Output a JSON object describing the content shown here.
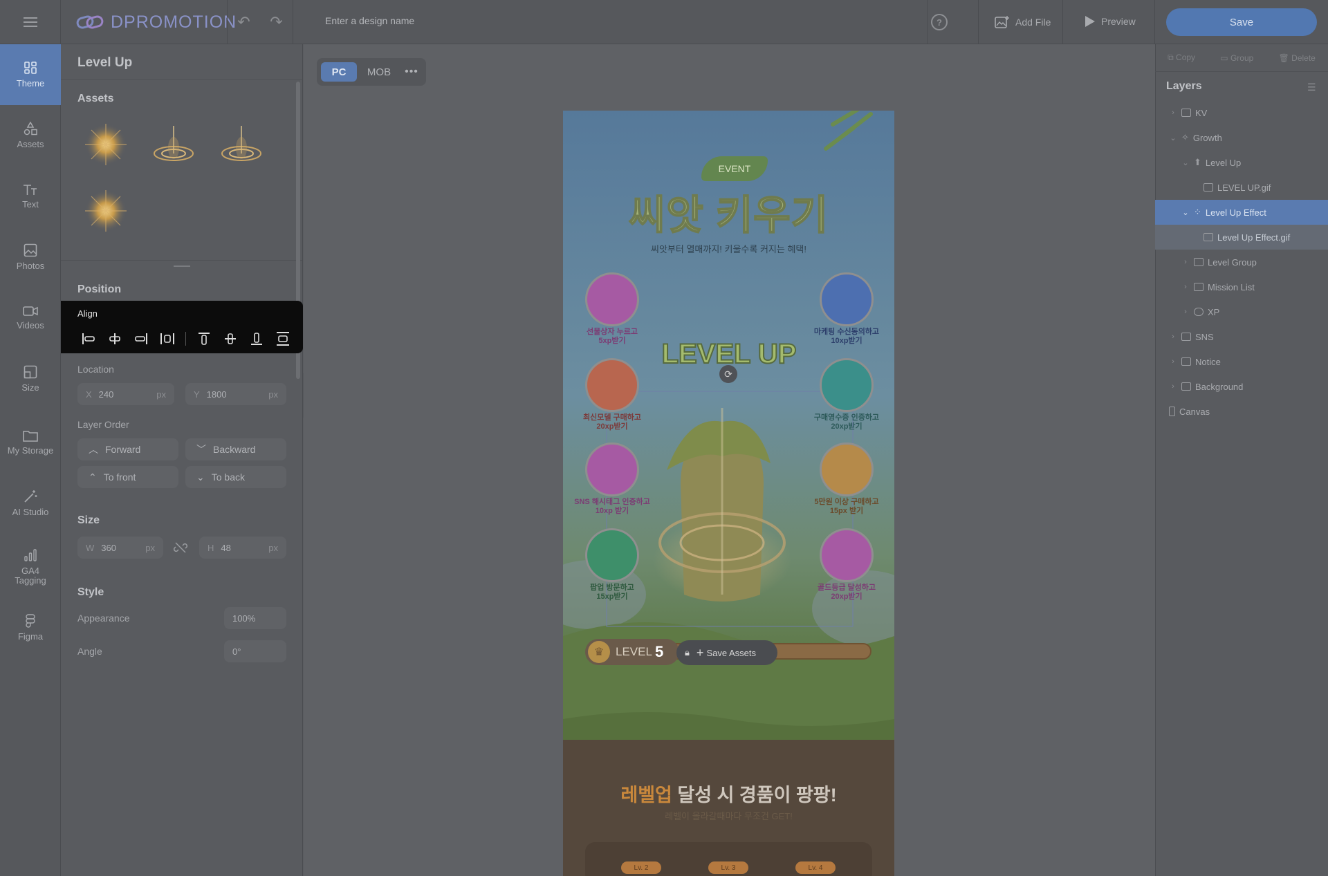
{
  "app": {
    "brand": "DPROMOTION",
    "design_name_placeholder": "Enter a design name"
  },
  "topbar": {
    "add_file": "Add File",
    "preview": "Preview",
    "save": "Save"
  },
  "nav": [
    {
      "label": "Theme",
      "icon": "theme-icon"
    },
    {
      "label": "Assets",
      "icon": "shapes-icon"
    },
    {
      "label": "Text",
      "icon": "text-icon"
    },
    {
      "label": "Photos",
      "icon": "image-icon"
    },
    {
      "label": "Videos",
      "icon": "video-icon"
    },
    {
      "label": "Size",
      "icon": "resize-icon"
    },
    {
      "label": "My Storage",
      "icon": "folder-icon"
    },
    {
      "label": "AI Studio",
      "icon": "magic-wand-icon"
    },
    {
      "label": "GA4 Tagging",
      "icon": "chart-icon"
    },
    {
      "label": "Figma",
      "icon": "figma-icon"
    }
  ],
  "panel": {
    "title": "Level Up",
    "assets_title": "Assets",
    "position_title": "Position",
    "align_title": "Align",
    "location_label": "Location",
    "x_label": "X",
    "x_value": "240",
    "x_unit": "px",
    "y_label": "Y",
    "y_value": "1800",
    "y_unit": "px",
    "layer_order_label": "Layer Order",
    "forward": "Forward",
    "backward": "Backward",
    "to_front": "To front",
    "to_back": "To back",
    "size_title": "Size",
    "w_label": "W",
    "w_value": "360",
    "w_unit": "px",
    "h_label": "H",
    "h_value": "48",
    "h_unit": "px",
    "style_title": "Style",
    "appearance_label": "Appearance",
    "appearance_value": "100%",
    "angle_label": "Angle",
    "angle_value": "0°"
  },
  "device": {
    "pc": "PC",
    "mob": "MOB"
  },
  "design": {
    "event_badge": "EVENT",
    "title": "씨앗 키우기",
    "subtitle": "씨앗부터 열매까지! 키울수록 커지는 혜택!",
    "levelup_text": "LEVEL UP",
    "missions_left": [
      {
        "l1": "선물상자 누르고",
        "l2": "5xp받기",
        "color": "#a65aa3"
      },
      {
        "l1": "최신모델 구매하고",
        "l2": "20xp받기",
        "color": "#b8664f"
      },
      {
        "l1": "SNS 해시태그 인증하고",
        "l2": "10xp 받기",
        "color": "#a65aa3"
      },
      {
        "l1": "팝업 방문하고",
        "l2": "15xp받기",
        "color": "#3e8f6a"
      }
    ],
    "missions_right": [
      {
        "l1": "마케팅 수신동의하고",
        "l2": "10xp받기",
        "color": "#4d6fb0"
      },
      {
        "l1": "구매영수증 인증하고",
        "l2": "20xp받기",
        "color": "#3b8f8a"
      },
      {
        "l1": "5만원 이상 구매하고",
        "l2": "15px 받기",
        "color": "#b58a4a"
      },
      {
        "l1": "골드등급 달성하고",
        "l2": "20xp받기",
        "color": "#a65aa3"
      }
    ],
    "level_label": "LEVEL",
    "level_num": "5",
    "save_assets": "Save Assets",
    "prize_title_a": "레벨업",
    "prize_title_b": " 달성 시 경품이 팡팡!",
    "prize_sub": "레벨이 올라갈때마다 무조건 GET!",
    "lv_tags": [
      "Lv. 2",
      "Lv. 3",
      "Lv. 4"
    ]
  },
  "right": {
    "copy": "Copy",
    "group": "Group",
    "delete": "Delete",
    "layers_title": "Layers",
    "layers": [
      {
        "label": "KV"
      },
      {
        "label": "Growth"
      },
      {
        "label": "Level Up"
      },
      {
        "label": "LEVEL UP.gif"
      },
      {
        "label": "Level Up Effect"
      },
      {
        "label": "Level Up Effect.gif"
      },
      {
        "label": "Level Group"
      },
      {
        "label": "Mission List"
      },
      {
        "label": "XP"
      },
      {
        "label": "SNS"
      },
      {
        "label": "Notice"
      },
      {
        "label": "Background"
      },
      {
        "label": "Canvas"
      }
    ]
  },
  "colors": {
    "accent": "#5a7bb0",
    "overlay": "#5b5d61",
    "highlight": "#d98a3a"
  }
}
